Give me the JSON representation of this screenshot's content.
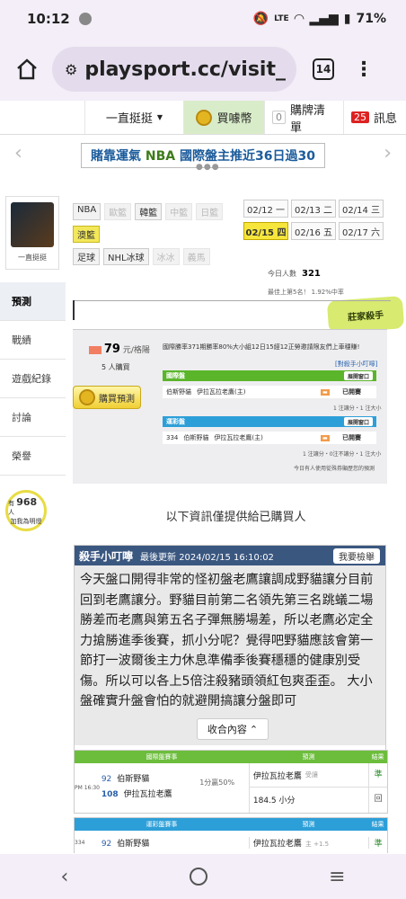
{
  "status": {
    "time": "10:12",
    "battery": "71%"
  },
  "browser": {
    "url": "playsport.cc/visit_",
    "tab_count": "14"
  },
  "topnav": {
    "user": "一直挺挺",
    "coin": "買噱幣",
    "cart_count": "0",
    "cart": "購牌清單",
    "msg_count": "25",
    "msg": "訊息"
  },
  "banner": {
    "lead": "賭靠運氣",
    "mid": "NBA",
    "rest": "國際盤主推近36日過30"
  },
  "sidebar": {
    "name": "一直挺挺",
    "items": [
      "預測",
      "戰績",
      "遊戲紀錄",
      "討論",
      "榮譽"
    ],
    "bulb_label_top": "有",
    "bulb_count": "968",
    "bulb_unit": "人",
    "bulb_label_bottom": "加我為明燈"
  },
  "leagues": {
    "row1": [
      "NBA",
      "歐籃",
      "韓籃",
      "中籃",
      "日籃"
    ],
    "row2": [
      "澳籃"
    ],
    "row3": [
      "足球",
      "NHL冰球",
      "冰冰",
      "義馬"
    ]
  },
  "dates": [
    "02/12 一",
    "02/13 二",
    "02/14 三",
    "02/15 四",
    "02/16 五",
    "02/17 六"
  ],
  "stats": {
    "today_label": "今日人數",
    "today_count": "321",
    "max_line": "最佳上第5名！ 1.92%中率"
  },
  "killer": "莊家殺手",
  "panel": {
    "price": "79",
    "price_unit": "元/格陽",
    "buyers": "5 人購買",
    "buy_btn": "購買預測",
    "notice": "國際勝率371期勝率80%大小組12日15經12正勞邀請限友們上車穩賺!",
    "link1": "[對殺手小叮嚀]",
    "intl_title": "國際盤",
    "open_label": "展開窗口",
    "row1_away": "伯斯野貓",
    "row1_home": "伊拉瓦拉老鷹(主)",
    "row1_status": "已開賽",
    "sub_line1": "1 注讓分・1 注大小",
    "lottery_title": "運彩盤",
    "row2_num": "334",
    "row2_away": "伯斯野貓",
    "row2_home": "伊拉瓦拉老鷹(主)",
    "row2_status": "已開賽",
    "sub_line2": "1 注讓分・0注不讓分・1 注大小",
    "foot": "今日有人使用從殊券顯歷您的預測"
  },
  "note": "以下資訊僅提供給已購買人",
  "tip": {
    "title": "殺手小叮嚀",
    "updated": "最後更新 2024/02/15 16:10:02",
    "subscribe": "我要檢舉",
    "body": "今天盤口開得非常的怪初盤老鷹讓調成野貓讓分目前回到老鷹讓分。野貓目前第二名領先第三名跳蟻二場勝差而老鷹與第五名子彈無勝場差，所以老鷹必定全力搶勝進季後賽，抓小分呢？覺得吧野貓應該會第一節打一波爾後主力休息準備季後賽穩穩的健康別受傷。所以可以各上5倍注殺豬頭領紅包爽歪歪。 大小盤確實升盤會怕的就避開搞讓分盤即可",
    "collapse": "收合內容"
  },
  "table1": {
    "h1": "國際盤賽事",
    "h2": "預測",
    "h3": "結果",
    "time": "PM 16:30",
    "n1": "92",
    "t1": "伯斯野貓",
    "n2": "108",
    "t2": "伊拉瓦拉老鷹",
    "line": "1分贏50%",
    "p1": "伊拉瓦拉老鷹",
    "p1b": "受讓",
    "r1": "準",
    "p2": "184.5 小分",
    "r2": "回"
  },
  "table2": {
    "h1": "運彩盤賽事",
    "h2": "預測",
    "h3": "結果",
    "num": "334",
    "n1": "92",
    "t1": "伯斯野貓",
    "p1": "伊拉瓦拉老鷹",
    "p1b": "主 +1.5",
    "r1": "準"
  }
}
